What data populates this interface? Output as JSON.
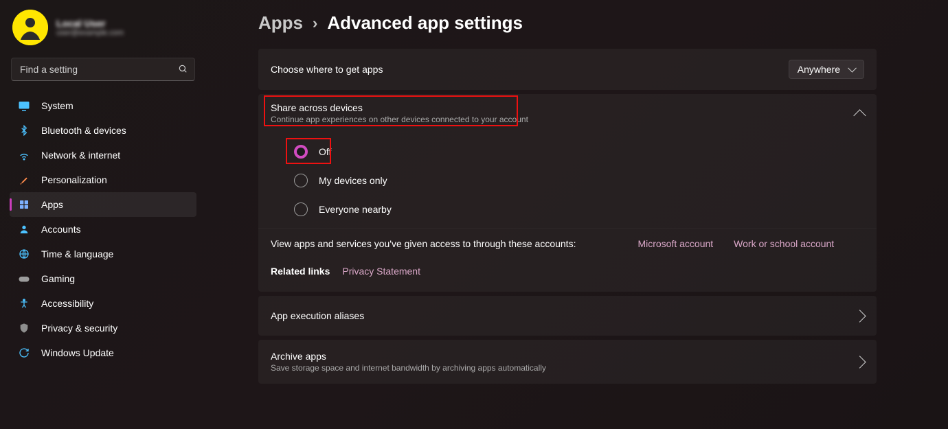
{
  "profile": {
    "name": "Local User",
    "email": "user@example.com"
  },
  "search": {
    "placeholder": "Find a setting"
  },
  "nav": [
    {
      "key": "system",
      "label": "System"
    },
    {
      "key": "bluetooth",
      "label": "Bluetooth & devices"
    },
    {
      "key": "network",
      "label": "Network & internet"
    },
    {
      "key": "personalization",
      "label": "Personalization"
    },
    {
      "key": "apps",
      "label": "Apps"
    },
    {
      "key": "accounts",
      "label": "Accounts"
    },
    {
      "key": "time",
      "label": "Time & language"
    },
    {
      "key": "gaming",
      "label": "Gaming"
    },
    {
      "key": "accessibility",
      "label": "Accessibility"
    },
    {
      "key": "privacy",
      "label": "Privacy & security"
    },
    {
      "key": "update",
      "label": "Windows Update"
    }
  ],
  "breadcrumb": {
    "root": "Apps",
    "separator": "›",
    "current": "Advanced app settings"
  },
  "where_to_get": {
    "title": "Choose where to get apps",
    "selected": "Anywhere"
  },
  "share": {
    "title": "Share across devices",
    "subtitle": "Continue app experiences on other devices connected to your account",
    "options": [
      "Off",
      "My devices only",
      "Everyone nearby"
    ],
    "selected_index": 0
  },
  "access": {
    "lead": "View apps and services you've given access to through these accounts:",
    "links": [
      "Microsoft account",
      "Work or school account"
    ]
  },
  "related": {
    "lead": "Related links",
    "links": [
      "Privacy Statement"
    ]
  },
  "rows": {
    "aliases": {
      "title": "App execution aliases"
    },
    "archive": {
      "title": "Archive apps",
      "subtitle": "Save storage space and internet bandwidth by archiving apps automatically"
    }
  }
}
